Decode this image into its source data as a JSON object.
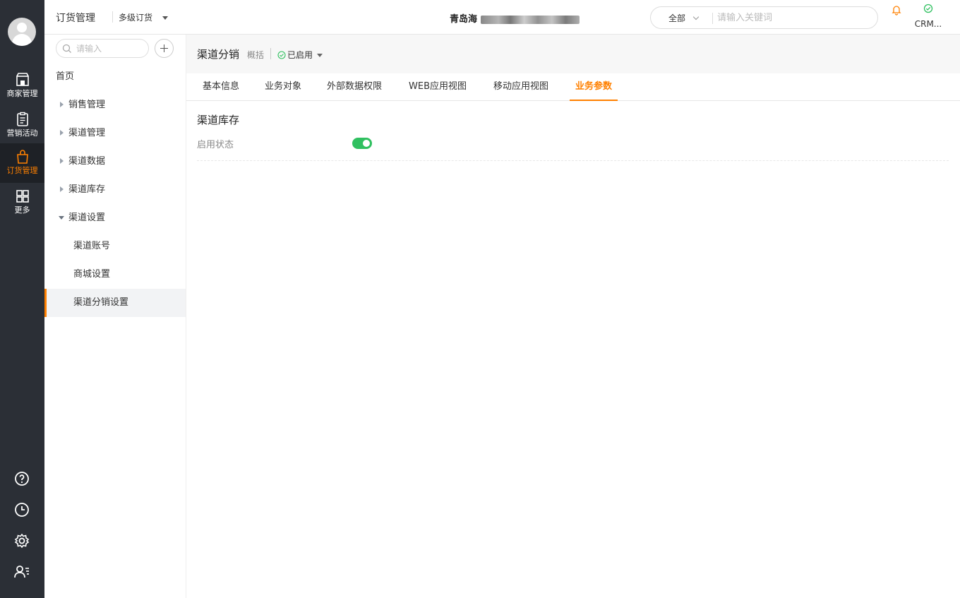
{
  "rail": {
    "items": [
      {
        "label": "商家管理",
        "icon": "store-icon"
      },
      {
        "label": "营销活动",
        "icon": "clipboard-icon"
      },
      {
        "label": "订货管理",
        "icon": "shopping-bag-icon",
        "active": true
      },
      {
        "label": "更多",
        "icon": "grid-icon"
      }
    ],
    "bottom_icons": [
      "help-icon",
      "clock-icon",
      "settings-icon",
      "user-list-icon"
    ]
  },
  "header": {
    "app_title": "订货管理",
    "sub_select": "多级订货",
    "company": "青岛海",
    "search": {
      "scope": "全部",
      "placeholder": "请输入关键词"
    },
    "crm_label": "CRM..."
  },
  "nav": {
    "search_placeholder": "请输入",
    "items": [
      {
        "label": "首页",
        "type": "plain"
      },
      {
        "label": "销售管理",
        "type": "collapsed"
      },
      {
        "label": "渠道管理",
        "type": "collapsed"
      },
      {
        "label": "渠道数据",
        "type": "collapsed"
      },
      {
        "label": "渠道库存",
        "type": "collapsed"
      },
      {
        "label": "渠道设置",
        "type": "expanded"
      },
      {
        "label": "渠道账号",
        "type": "child"
      },
      {
        "label": "商城设置",
        "type": "child"
      },
      {
        "label": "渠道分销设置",
        "type": "child",
        "selected": true
      }
    ]
  },
  "object": {
    "title": "渠道分销",
    "summary": "概括",
    "status": "已启用"
  },
  "tabs": [
    {
      "label": "基本信息"
    },
    {
      "label": "业务对象"
    },
    {
      "label": "外部数据权限"
    },
    {
      "label": "WEB应用视图"
    },
    {
      "label": "移动应用视图"
    },
    {
      "label": "业务参数",
      "active": true
    }
  ],
  "params": {
    "section_title": "渠道库存",
    "field_label": "启用状态",
    "enabled": true
  },
  "colors": {
    "accent": "#ff8000",
    "rail_bg": "#2b2f36",
    "toggle_on": "#30c060",
    "status_ok": "#30c060"
  }
}
